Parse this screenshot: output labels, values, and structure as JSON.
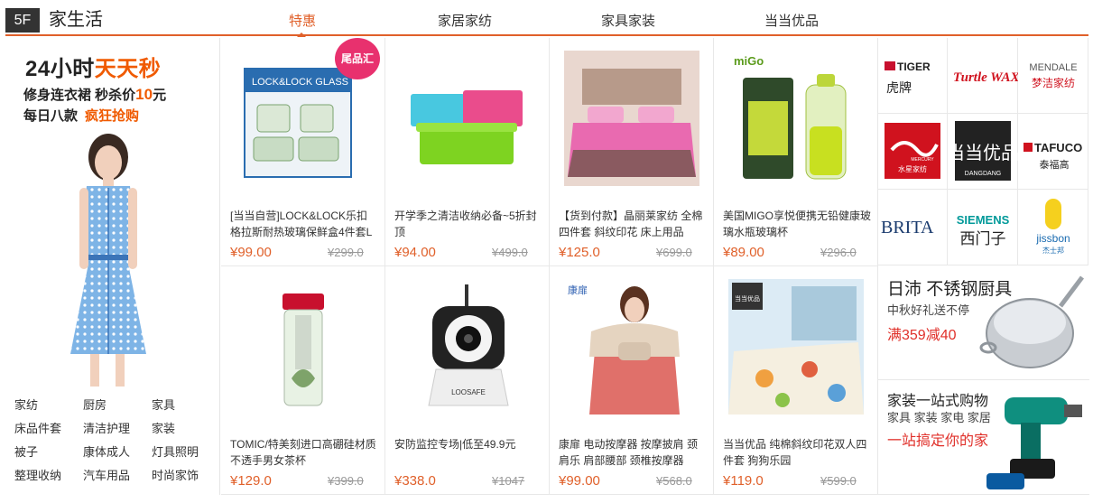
{
  "header": {
    "floor": "5F",
    "title": "家生活",
    "tabs": [
      "特惠",
      "家居家纺",
      "家具家装",
      "当当优品"
    ],
    "active_tab": "特惠"
  },
  "promo": {
    "title_a": "24小时",
    "title_b": "天天秒",
    "line1_a": "修身连衣裙 秒杀价",
    "line1_price": "10",
    "line1_unit": "元",
    "line2_a": "每日八款",
    "line2_b": "疯狂抢购",
    "categories": [
      "家纺",
      "厨房",
      "家具",
      "床品件套",
      "清洁护理",
      "家装",
      "被子",
      "康体成人",
      "灯具照明",
      "整理收纳",
      "汽车用品",
      "时尚家饰"
    ]
  },
  "products": [
    {
      "name": "[当当自营]LOCK&LOCK乐扣 格拉斯耐热玻璃保鲜盒4件套L",
      "price": "¥99.00",
      "old": "¥299.0",
      "badge": "尾品汇",
      "icon": "glass-food-container"
    },
    {
      "name": "开学季之清洁收纳必备~5折封顶",
      "price": "¥94.00",
      "old": "¥499.0",
      "icon": "storage-box"
    },
    {
      "name": "【货到付款】晶丽莱家纺 全棉四件套 斜纹印花 床上用品",
      "price": "¥125.0",
      "old": "¥699.0",
      "icon": "bedding-set"
    },
    {
      "name": "美国MIGO享悦便携无铅健康玻璃水瓶玻璃杯",
      "price": "¥89.00",
      "old": "¥296.0",
      "icon": "water-bottle",
      "brand": "miGo"
    },
    {
      "name": "TOMIC/特美刻进口高硼硅材质 不透手男女茶杯",
      "price": "¥129.0",
      "old": "¥399.0",
      "icon": "tea-cup"
    },
    {
      "name": "安防监控专场|低至49.9元",
      "price": "¥338.0",
      "old": "¥1047",
      "icon": "security-camera",
      "brand": "LOOSAFE"
    },
    {
      "name": "康扉 电动按摩器 按摩披肩 颈肩乐 肩部腰部 颈椎按摩器",
      "price": "¥99.00",
      "old": "¥568.0",
      "icon": "massager",
      "brand": "康扉"
    },
    {
      "name": "当当优品 纯棉斜纹印花双人四件套 狗狗乐园",
      "price": "¥119.0",
      "old": "¥599.0",
      "icon": "bedding-dog",
      "brand": "当当优品"
    }
  ],
  "brands": [
    {
      "name": "TIGER",
      "sub": "虎牌"
    },
    {
      "name": "Turtle WAX",
      "sub": ""
    },
    {
      "name": "MENDALE",
      "sub": "梦洁家纺"
    },
    {
      "name": "MERCURY",
      "sub": "水星家纺"
    },
    {
      "name": "当当优品",
      "sub": "DANGDANG"
    },
    {
      "name": "TAFUCO",
      "sub": "泰福高"
    },
    {
      "name": "BRITA",
      "sub": ""
    },
    {
      "name": "SIEMENS",
      "sub": "西门子"
    },
    {
      "name": "jissbon",
      "sub": "杰士邦"
    }
  ],
  "ads": [
    {
      "title": "日沛 不锈钢厨具",
      "sub": "中秋好礼送不停",
      "hl": "满359减40"
    },
    {
      "title": "家装一站式购物",
      "sub": "家具 家装 家电 家居",
      "hl": "一站搞定你的家"
    }
  ],
  "colors": {
    "accent": "#e0602a",
    "hot": "#f05a00",
    "badge": "#e8316e"
  }
}
